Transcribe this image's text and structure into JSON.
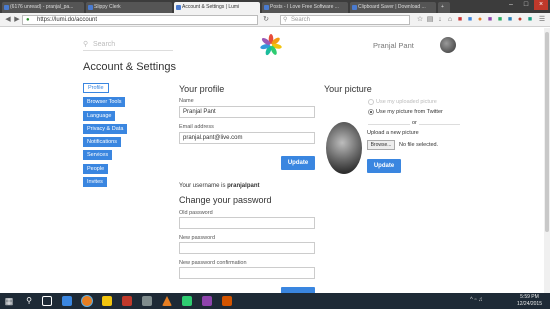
{
  "browser": {
    "tabs": [
      {
        "label": "(6176 unread) - pranjal_pa..."
      },
      {
        "label": "Slippy Clerk"
      },
      {
        "label": "Account & Settings | Lumi"
      },
      {
        "label": "Posts - I Love Free Software ..."
      },
      {
        "label": "Clipboard Saver | Download ..."
      }
    ],
    "url": "https://lumi.do/account",
    "search_placeholder": "Search"
  },
  "header": {
    "search_placeholder": "Search",
    "user_name": "Pranjal Pant"
  },
  "page_title": "Account & Settings",
  "menu": [
    {
      "label": "Profile"
    },
    {
      "label": "Browser Tools"
    },
    {
      "label": "Language"
    },
    {
      "label": "Privacy & Data"
    },
    {
      "label": "Notifications"
    },
    {
      "label": "Services"
    },
    {
      "label": "People"
    },
    {
      "label": "Invites"
    }
  ],
  "profile": {
    "title": "Your profile",
    "name_label": "Name",
    "name_value": "Pranjal Pant",
    "email_label": "Email address",
    "email_value": "pranjal.pant@live.com",
    "update_label": "Update",
    "username_prefix": "Your username is ",
    "username": "pranjalpant"
  },
  "password": {
    "title": "Change your password",
    "old_label": "Old password",
    "new_label": "New password",
    "confirm_label": "New password confirmation"
  },
  "picture": {
    "title": "Your picture",
    "option_uploaded": "Use my uploaded picture",
    "option_twitter": "Use my picture from Twitter",
    "or_text": "or",
    "upload_label": "Upload a new picture",
    "browse_label": "Browse...",
    "no_file": "No file selected.",
    "update_label": "Update"
  },
  "taskbar": {
    "time": "5:59 PM",
    "date": "12/24/2015"
  }
}
